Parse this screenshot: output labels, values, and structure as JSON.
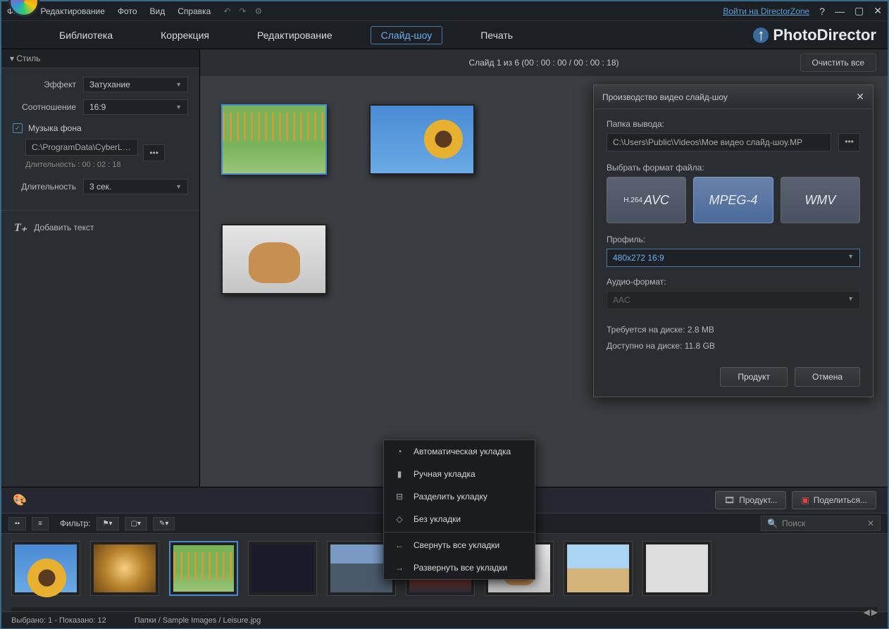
{
  "menu": {
    "file": "Файл",
    "edit": "Редактирование",
    "photo": "Фото",
    "view": "Вид",
    "help": "Справка"
  },
  "header": {
    "dz_link": "Войти на DirectorZone",
    "brand": "PhotoDirector"
  },
  "tabs": {
    "library": "Библиотека",
    "correction": "Коррекция",
    "editing": "Редактирование",
    "slideshow": "Слайд-шоу",
    "print": "Печать"
  },
  "style": {
    "title": "Стиль",
    "effect_label": "Эффект",
    "effect_value": "Затухание",
    "ratio_label": "Соотношение",
    "ratio_value": "16:9",
    "music_label": "Музыка фона",
    "music_path": "C:\\ProgramData\\CyberLin...",
    "music_duration": "Длительность : 00 : 02 : 18",
    "duration_label": "Длительность",
    "duration_value": "3 сек.",
    "add_text": "Добавить текст"
  },
  "canvas": {
    "info": "Слайд   1 из   6 (00 : 00 : 00 / 00 : 00 : 18)",
    "clear": "Очистить все"
  },
  "dialog": {
    "title": "Производство видео слайд-шоу",
    "output_label": "Папка вывода:",
    "output_path": "C:\\Users\\Public\\Videos\\Мое видео слайд-шоу.MP",
    "format_label": "Выбрать формат файла:",
    "f1_sup": "H.264",
    "f1": "AVC",
    "f2": "MPEG-4",
    "f3": "WMV",
    "profile_label": "Профиль:",
    "profile_value": "480x272 16:9",
    "audio_label": "Аудио-формат:",
    "audio_value": "AAC",
    "disk_req": "Требуется на диске: 2.8 MB",
    "disk_avail": "Доступно на диске: 11.8 GB",
    "produce": "Продукт",
    "cancel": "Отмена"
  },
  "context": {
    "auto": "Автоматическая укладка",
    "manual": "Ручная укладка",
    "split": "Разделить укладку",
    "none": "Без укладки",
    "collapse": "Свернуть все укладки",
    "expand": "Развернуть все укладки"
  },
  "bottom": {
    "produce": "Продукт...",
    "share": "Поделиться...",
    "filter": "Фильтр:",
    "search": "Поиск",
    "status1": "Выбрано: 1 - Показано: 12",
    "status2": "Папки / Sample Images / Leisure.jpg"
  }
}
